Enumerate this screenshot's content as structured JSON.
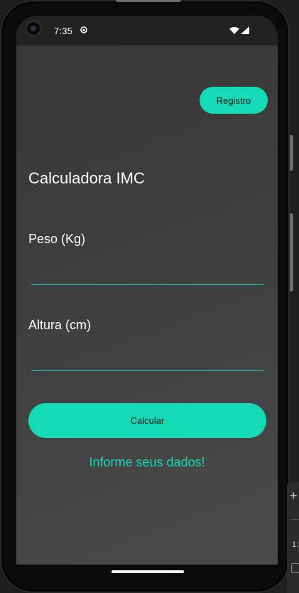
{
  "status_bar": {
    "time": "7:35",
    "icons": [
      "camera-icon",
      "notification-dot-icon",
      "wifi-icon",
      "signal-icon"
    ]
  },
  "header": {
    "registro_label": "Registro"
  },
  "main": {
    "title": "Calculadora IMC",
    "peso_label": "Peso (Kg)",
    "peso_value": "",
    "altura_label": "Altura (cm)",
    "altura_value": "",
    "calcular_label": "Calcular",
    "result_text": "Informe seus dados!"
  },
  "emulator_toolbar": {
    "partial_number": "1:"
  },
  "colors": {
    "accent": "#14dbb5",
    "background": "#3d3d3d",
    "text": "#ffffff"
  }
}
